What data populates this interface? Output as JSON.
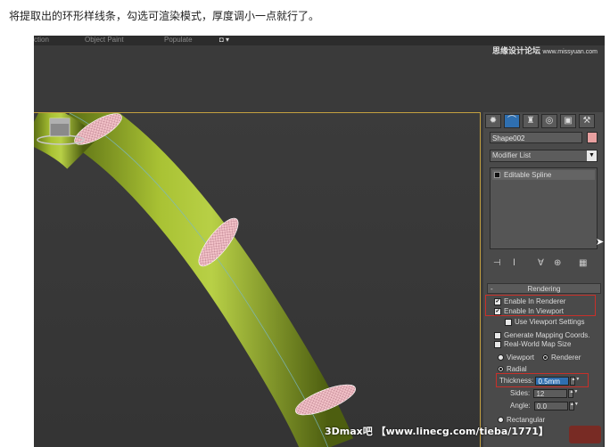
{
  "caption": "将提取出的环形样线条，勾选可渲染模式，厚度调小一点就行了。",
  "topbar": {
    "items": [
      "ction",
      "Object Paint",
      "Populate"
    ]
  },
  "site_watermark_top": "思缘设计论坛",
  "site_watermark_top_url": "www.missyuan.com",
  "panel": {
    "tabs": [
      {
        "icon": "sun-icon",
        "glyph": "✹"
      },
      {
        "icon": "modify-curve-icon",
        "glyph": "⌒"
      },
      {
        "icon": "hierarchy-icon",
        "glyph": "♜"
      },
      {
        "icon": "motion-icon",
        "glyph": "◎"
      },
      {
        "icon": "display-icon",
        "glyph": "▣"
      },
      {
        "icon": "utilities-hammer-icon",
        "glyph": "⚒"
      }
    ],
    "object_name": "Shape002",
    "object_color": "#e8a0a0",
    "modifier_list_label": "Modifier List",
    "stack_items": [
      "Editable Spline"
    ],
    "stack_toolbar": [
      "⊣",
      "Ⅰ",
      "∀",
      "⊕",
      "▦"
    ],
    "rendering": {
      "title": "Rendering",
      "enable_in_renderer": "Enable In Renderer",
      "enable_in_viewport": "Enable In Viewport",
      "use_viewport_settings": "Use Viewport Settings",
      "generate_mapping": "Generate Mapping Coords.",
      "real_world_map": "Real-World Map Size",
      "viewport_label": "Viewport",
      "renderer_label": "Renderer",
      "radial_label": "Radial",
      "thickness_label": "Thickness:",
      "thickness_value": "0.5mm",
      "sides_label": "Sides:",
      "sides_value": "12",
      "angle_label": "Angle:",
      "angle_value": "0.0",
      "rectangular_label": "Rectangular"
    }
  },
  "bottom_watermark": "3Dmax吧 【www.linecg.com/tieba/1771】",
  "colors": {
    "highlight": "#c8302a",
    "tube": "#9ab52a",
    "ring": "#f0b8c0",
    "accent": "#c4a040"
  }
}
